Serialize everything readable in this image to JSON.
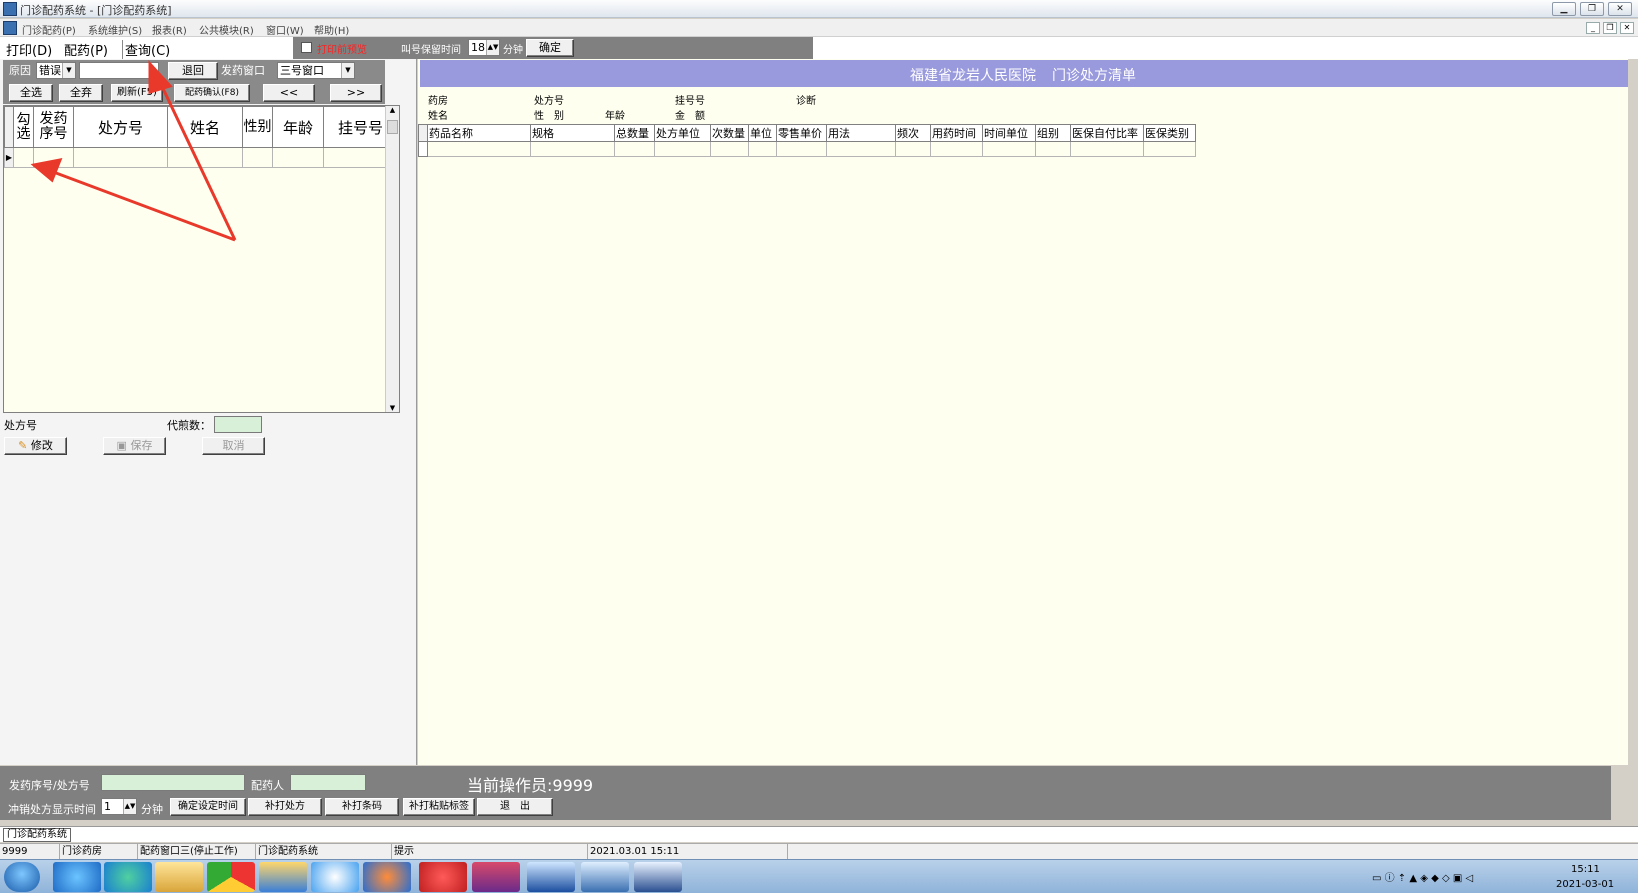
{
  "window": {
    "title": "门诊配药系统 - [门诊配药系统]"
  },
  "menu": [
    "门诊配药(P)",
    "系统维护(S)",
    "报表(R)",
    "公共模块(R)",
    "窗口(W)",
    "帮助(H)"
  ],
  "toolbar": {
    "print": "打印(D)",
    "dispense": "配药(P)",
    "query": "查询(C)"
  },
  "options": {
    "preview_label": "打印前预览",
    "hold_label": "叫号保留时间",
    "hold_value": "18",
    "minute_label": "分钟",
    "confirm_label": "确定"
  },
  "filter": {
    "reason_label": "原因",
    "reason_value": "错误",
    "return_label": "退回",
    "window_label": "发药窗口",
    "window_value": "三号窗口"
  },
  "buttons": {
    "select_all": "全选",
    "deselect_all": "全弃",
    "refresh": "刷新(F5)",
    "confirm_dispense": "配药确认(F8)",
    "prev": "<<",
    "next": ">>"
  },
  "left_grid": {
    "columns": [
      "勾选",
      "发药序号",
      "处方号",
      "姓名",
      "性别",
      "年龄",
      "挂号号"
    ]
  },
  "left_bottom": {
    "rx_label": "处方号",
    "decoct_label": "代煎数：",
    "modify": "修改",
    "save": "保存",
    "cancel": "取消"
  },
  "right": {
    "hospital": "福建省龙岩人民医院",
    "list_title": "门诊处方清单",
    "info": {
      "pharmacy": "药房",
      "rx_no": "处方号",
      "reg_no": "挂号号",
      "diagnosis": "诊断",
      "name": "姓名",
      "sex": "性　别",
      "age": "年龄",
      "amount": "金　额"
    },
    "columns": [
      "药品名称",
      "规格",
      "总数量",
      "处方单位",
      "次数量",
      "单位",
      "零售单价",
      "用法",
      "频次",
      "用药时间",
      "时间单位",
      "组别",
      "医保自付比率",
      "医保类别"
    ]
  },
  "bottom": {
    "serial_label": "发药序号/处方号",
    "pharmacist_label": "配药人",
    "operator": "当前操作员:9999",
    "reversal_label": "冲销处方显示时间",
    "reversal_value": "1",
    "minute_label": "分钟",
    "set_time": "确定设定时间",
    "reprint_rx": "补打处方",
    "reprint_barcode": "补打条码",
    "reprint_label": "补打粘贴标签",
    "exit": "退　出"
  },
  "mdi_tab": "门诊配药系统",
  "status": [
    "9999",
    "门诊药房",
    "配药窗口三(停止工作)",
    "门诊配药系统",
    "提示",
    "2021.03.01 15:11"
  ],
  "clock": {
    "time": "15:11",
    "date": "2021-03-01"
  },
  "colors": {
    "banner": "#9999dd",
    "grid_bg": "#fffff0",
    "annotation": "#e8392b"
  }
}
